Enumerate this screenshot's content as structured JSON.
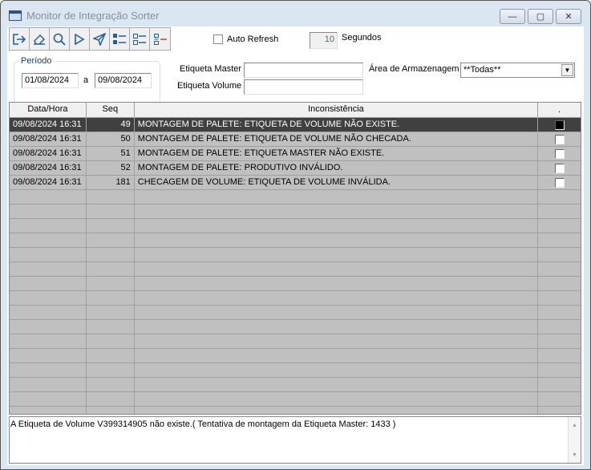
{
  "window": {
    "title": "Monitor de Integração Sorter",
    "minimize": "▭",
    "maximize": "▣",
    "close": "✕"
  },
  "toolbar": {
    "icons": [
      "exit-icon",
      "eraser-icon",
      "search-icon",
      "play-icon",
      "send-icon",
      "checklist-checked-icon",
      "checklist-icon",
      "checklist-remove-icon"
    ]
  },
  "auto_refresh": {
    "label": "Auto Refresh",
    "checked": false,
    "seconds": "10",
    "seconds_label": "Segundos"
  },
  "periodo": {
    "legend": "Período",
    "from": "01/08/2024",
    "sep": "a",
    "to": "09/08/2024"
  },
  "filters": {
    "master_label": "Etiqueta Master",
    "master_value": "",
    "volume_label": "Etiqueta Volume",
    "volume_value": "",
    "area_label": "Área de Armazenagem",
    "area_value": "**Todas**"
  },
  "grid": {
    "headers": [
      "Data/Hora",
      "Seq",
      "Inconsistência",
      "."
    ],
    "rows": [
      {
        "data": "09/08/2024 16:31",
        "seq": "49",
        "text": "MONTAGEM DE PALETE: ETIQUETA DE VOLUME NÃO EXISTE.",
        "checked": true,
        "selected": true
      },
      {
        "data": "09/08/2024 16:31",
        "seq": "50",
        "text": "MONTAGEM DE PALETE: ETIQUETA DE VOLUME NÃO CHECADA.",
        "checked": false
      },
      {
        "data": "09/08/2024 16:31",
        "seq": "51",
        "text": "MONTAGEM DE PALETE: ETIQUETA MASTER NÃO EXISTE.",
        "checked": false
      },
      {
        "data": "09/08/2024 16:31",
        "seq": "52",
        "text": "MONTAGEM DE PALETE: PRODUTIVO INVÁLIDO.",
        "checked": false
      },
      {
        "data": "09/08/2024 16:31",
        "seq": "181",
        "text": "CHECAGEM DE VOLUME: ETIQUETA DE VOLUME INVÁLIDA.",
        "checked": false
      }
    ]
  },
  "detail": {
    "text": "A Etiqueta de Volume V399314905 não existe.( Tentativa de montagem da Etiqueta Master: 1433 )"
  }
}
